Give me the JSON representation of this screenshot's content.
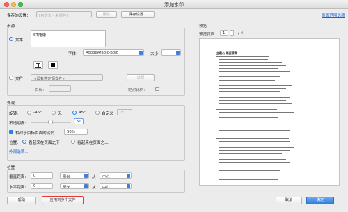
{
  "window": {
    "title": "添加水印"
  },
  "top": {
    "saved_settings_label": "保存的设置：",
    "saved_settings_value": "[自定义 - 未保存]",
    "delete_label": "删除",
    "save_settings_label": "保存设置...",
    "page_range_link": "页面范围选项"
  },
  "source": {
    "group_label": "来源",
    "text_radio_label": "文本",
    "text_value": "ST隆康",
    "font_label": "字体:",
    "font_value": "AdobeArabic-Bold",
    "size_label": "大小:",
    "file_radio_label": "文件",
    "file_value": "<没有选定源文件>",
    "browse_label": "选择",
    "page_label": "页码:",
    "absolute_scale_label": "绝对比例:"
  },
  "appearance": {
    "group_label": "外观",
    "rotation_label": "旋转:",
    "rot_neg45": "-45°",
    "rot_0": "无",
    "rot_45": "45°",
    "rot_custom": "自定义",
    "rot_custom_value": "0°",
    "opacity_label": "不透明度:",
    "opacity_value": "50",
    "relative_scale_label": "相对于目标页面的比例",
    "relative_scale_value": "50%",
    "position_label": "位置:",
    "behind_page": "看起来在页面之下",
    "above_page": "看起来在页面之上",
    "advanced_link": "外观选项..."
  },
  "position": {
    "group_label": "位置",
    "vertical_label": "垂直距离:",
    "vertical_value": "0",
    "vertical_unit": "厘米",
    "vertical_from": "从",
    "vertical_anchor": "中心",
    "horizontal_label": "水平距离:",
    "horizontal_value": "0",
    "horizontal_unit": "厘米",
    "horizontal_from": "从",
    "horizontal_anchor": "中心"
  },
  "preview": {
    "group_label": "预览",
    "page_label": "预览页面",
    "page_value": "1",
    "page_total": "/ 4",
    "doc_title": "主题公 路面预算"
  },
  "footer": {
    "help_label": "帮助",
    "apply_multiple_label": "应用到多个文件",
    "cancel_label": "取消",
    "ok_label": "确定"
  },
  "colors": {
    "accent": "#2f7de1",
    "highlight": "#e53935"
  }
}
